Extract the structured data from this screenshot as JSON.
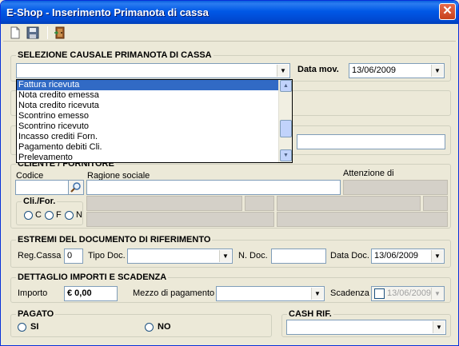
{
  "window": {
    "title": "E-Shop - Inserimento Primanota di cassa",
    "close_label": "✕"
  },
  "toolbar": {
    "icons": [
      "new-document-icon",
      "save-icon",
      "exit-door-icon"
    ]
  },
  "causale": {
    "section_label": "SELEZIONE CAUSALE PRIMANOTA DI CASSA",
    "value": "",
    "date_label": "Data mov.",
    "date_value": "13/06/2009",
    "options": [
      "Fattura ricevuta",
      "Nota credito emessa",
      "Nota credito ricevuta",
      "Scontrino emesso",
      "Scontrino ricevuto",
      "Incasso crediti Forn.",
      "Pagamento debiti Cli.",
      "Prelevamento"
    ],
    "selected_index": 0
  },
  "cliente": {
    "section_label": "CLIENTE / FORNITORE",
    "codice_label": "Codice",
    "codice_value": "",
    "ragione_label": "Ragione sociale",
    "ragione_value": "",
    "attenzione_label": "Attenzione di",
    "clifor_label": "Cli./For.",
    "radio_c": "C",
    "radio_f": "F",
    "radio_n": "N"
  },
  "documento": {
    "section_label": "ESTREMI DEL DOCUMENTO DI RIFERIMENTO",
    "regcassa_label": "Reg.Cassa",
    "regcassa_value": "0",
    "tipo_label": "Tipo Doc.",
    "tipo_value": "",
    "ndoc_label": "N. Doc.",
    "ndoc_value": "",
    "data_label": "Data Doc.",
    "data_value": "13/06/2009"
  },
  "importi": {
    "section_label": "DETTAGLIO IMPORTI E SCADENZA",
    "importo_label": "Importo",
    "importo_value": "€ 0,00",
    "mezzo_label": "Mezzo di pagamento",
    "mezzo_value": "",
    "scadenza_label": "Scadenza",
    "scadenza_value": "13/06/2009"
  },
  "pagato": {
    "section_label": "PAGATO",
    "si_label": "SI",
    "no_label": "NO"
  },
  "cash": {
    "section_label": "CASH RIF.",
    "value": ""
  }
}
